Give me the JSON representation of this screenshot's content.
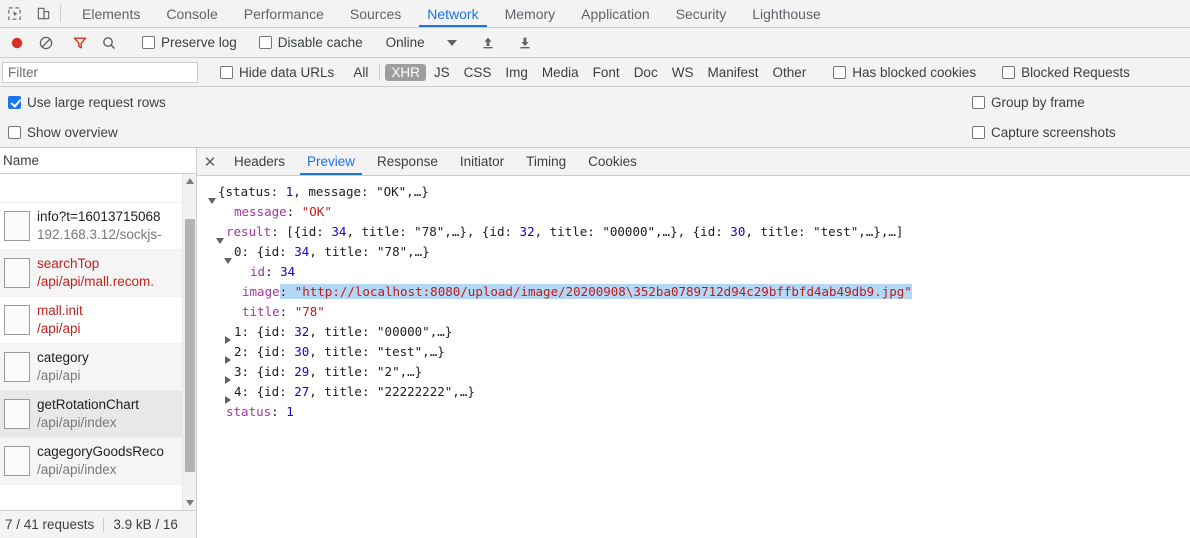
{
  "main_tabs": [
    {
      "label": "Elements",
      "active": false
    },
    {
      "label": "Console",
      "active": false
    },
    {
      "label": "Performance",
      "active": false
    },
    {
      "label": "Sources",
      "active": false
    },
    {
      "label": "Network",
      "active": true
    },
    {
      "label": "Memory",
      "active": false
    },
    {
      "label": "Application",
      "active": false
    },
    {
      "label": "Security",
      "active": false
    },
    {
      "label": "Lighthouse",
      "active": false
    }
  ],
  "toolbar": {
    "record_icon": "record-icon",
    "clear_icon": "clear-icon",
    "filter_icon": "filter-icon",
    "search_icon": "search-icon",
    "preserve_log": {
      "label": "Preserve log",
      "checked": false
    },
    "disable_cache": {
      "label": "Disable cache",
      "checked": false
    },
    "throttling": "Online",
    "import_icon": "upload-har-icon",
    "export_icon": "download-har-icon",
    "inspect_icon": "inspect-element-icon",
    "device_icon": "device-toolbar-icon"
  },
  "filterbar": {
    "placeholder": "Filter",
    "value": "",
    "hide_data_urls": {
      "label": "Hide data URLs",
      "checked": false
    },
    "types": [
      {
        "label": "All",
        "active": false
      },
      {
        "label": "XHR",
        "active": true
      },
      {
        "label": "JS",
        "active": false
      },
      {
        "label": "CSS",
        "active": false
      },
      {
        "label": "Img",
        "active": false
      },
      {
        "label": "Media",
        "active": false
      },
      {
        "label": "Font",
        "active": false
      },
      {
        "label": "Doc",
        "active": false
      },
      {
        "label": "WS",
        "active": false
      },
      {
        "label": "Manifest",
        "active": false
      },
      {
        "label": "Other",
        "active": false
      }
    ],
    "has_blocked_cookies": {
      "label": "Has blocked cookies",
      "checked": false
    },
    "blocked_requests": {
      "label": "Blocked Requests",
      "checked": false
    }
  },
  "settings": {
    "use_large_request_rows": {
      "label": "Use large request rows",
      "checked": true
    },
    "show_overview": {
      "label": "Show overview",
      "checked": false
    },
    "group_by_frame": {
      "label": "Group by frame",
      "checked": false
    },
    "capture_screenshots": {
      "label": "Capture screenshots",
      "checked": false
    }
  },
  "request_list": {
    "column_header": "Name",
    "rows": [
      {
        "name": "info?t=16013715068",
        "path": "192.168.3.12/sockjs-",
        "error": false,
        "selected": false
      },
      {
        "name": "searchTop",
        "path": "/api/api/mall.recom.",
        "error": true,
        "selected": false
      },
      {
        "name": "mall.init",
        "path": "/api/api",
        "error": true,
        "selected": false
      },
      {
        "name": "category",
        "path": "/api/api",
        "error": false,
        "selected": false
      },
      {
        "name": "getRotationChart",
        "path": "/api/api/index",
        "error": false,
        "selected": true
      },
      {
        "name": "cagegoryGoodsReco",
        "path": "/api/api/index",
        "error": false,
        "selected": false
      }
    ],
    "status": {
      "requests": "7 / 41 requests",
      "transferred": "3.9 kB / 16"
    }
  },
  "detail_tabs": [
    {
      "label": "Headers",
      "active": false
    },
    {
      "label": "Preview",
      "active": true
    },
    {
      "label": "Response",
      "active": false
    },
    {
      "label": "Initiator",
      "active": false
    },
    {
      "label": "Timing",
      "active": false
    },
    {
      "label": "Cookies",
      "active": false
    }
  ],
  "preview": {
    "lines": [
      {
        "indent": 0,
        "triangle": "open",
        "parts": [
          {
            "t": "{status: ",
            "c": "p"
          },
          {
            "t": "1",
            "c": "n"
          },
          {
            "t": ", message: ",
            "c": "p"
          },
          {
            "t": "\"OK\"",
            "c": "p"
          },
          {
            "t": ",…}",
            "c": "p"
          }
        ]
      },
      {
        "indent": 2,
        "triangle": "none",
        "parts": [
          {
            "t": "message",
            "c": "k"
          },
          {
            "t": ": ",
            "c": "p"
          },
          {
            "t": "\"OK\"",
            "c": "s"
          }
        ]
      },
      {
        "indent": 1,
        "triangle": "open",
        "parts": [
          {
            "t": "result",
            "c": "k"
          },
          {
            "t": ": [{id: ",
            "c": "p"
          },
          {
            "t": "34",
            "c": "n"
          },
          {
            "t": ", title: ",
            "c": "p"
          },
          {
            "t": "\"78\"",
            "c": "p"
          },
          {
            "t": ",…}, {id: ",
            "c": "p"
          },
          {
            "t": "32",
            "c": "n"
          },
          {
            "t": ", title: ",
            "c": "p"
          },
          {
            "t": "\"00000\"",
            "c": "p"
          },
          {
            "t": ",…}, {id: ",
            "c": "p"
          },
          {
            "t": "30",
            "c": "n"
          },
          {
            "t": ", title: ",
            "c": "p"
          },
          {
            "t": "\"test\"",
            "c": "p"
          },
          {
            "t": ",…},…]",
            "c": "p"
          }
        ]
      },
      {
        "indent": 2,
        "triangle": "open",
        "parts": [
          {
            "t": "0",
            "c": "p"
          },
          {
            "t": ": {id: ",
            "c": "p"
          },
          {
            "t": "34",
            "c": "n"
          },
          {
            "t": ", title: ",
            "c": "p"
          },
          {
            "t": "\"78\"",
            "c": "p"
          },
          {
            "t": ",…}",
            "c": "p"
          }
        ]
      },
      {
        "indent": 4,
        "triangle": "none",
        "parts": [
          {
            "t": "id",
            "c": "k"
          },
          {
            "t": ": ",
            "c": "p"
          },
          {
            "t": "34",
            "c": "n"
          }
        ]
      },
      {
        "indent": 3,
        "triangle": "none",
        "highlight_from": 1,
        "parts": [
          {
            "t": "image",
            "c": "k"
          },
          {
            "t": ": ",
            "c": "p"
          },
          {
            "t": "\"http://localhost:8080/upload/image/20200908\\352ba0789712d94c29bffbfd4ab49db9.jpg\"",
            "c": "s"
          }
        ]
      },
      {
        "indent": 3,
        "triangle": "none",
        "parts": [
          {
            "t": "title",
            "c": "k"
          },
          {
            "t": ": ",
            "c": "p"
          },
          {
            "t": "\"78\"",
            "c": "s"
          }
        ]
      },
      {
        "indent": 2,
        "triangle": "closed",
        "parts": [
          {
            "t": "1",
            "c": "p"
          },
          {
            "t": ": {id: ",
            "c": "p"
          },
          {
            "t": "32",
            "c": "n"
          },
          {
            "t": ", title: ",
            "c": "p"
          },
          {
            "t": "\"00000\"",
            "c": "p"
          },
          {
            "t": ",…}",
            "c": "p"
          }
        ]
      },
      {
        "indent": 2,
        "triangle": "closed",
        "parts": [
          {
            "t": "2",
            "c": "p"
          },
          {
            "t": ": {id: ",
            "c": "p"
          },
          {
            "t": "30",
            "c": "n"
          },
          {
            "t": ", title: ",
            "c": "p"
          },
          {
            "t": "\"test\"",
            "c": "p"
          },
          {
            "t": ",…}",
            "c": "p"
          }
        ]
      },
      {
        "indent": 2,
        "triangle": "closed",
        "parts": [
          {
            "t": "3",
            "c": "p"
          },
          {
            "t": ": {id: ",
            "c": "p"
          },
          {
            "t": "29",
            "c": "n"
          },
          {
            "t": ", title: ",
            "c": "p"
          },
          {
            "t": "\"2\"",
            "c": "p"
          },
          {
            "t": ",…}",
            "c": "p"
          }
        ]
      },
      {
        "indent": 2,
        "triangle": "closed",
        "parts": [
          {
            "t": "4",
            "c": "p"
          },
          {
            "t": ": {id: ",
            "c": "p"
          },
          {
            "t": "27",
            "c": "n"
          },
          {
            "t": ", title: ",
            "c": "p"
          },
          {
            "t": "\"22222222\"",
            "c": "p"
          },
          {
            "t": ",…}",
            "c": "p"
          }
        ]
      },
      {
        "indent": 1,
        "triangle": "none",
        "parts": [
          {
            "t": "status",
            "c": "k"
          },
          {
            "t": ": ",
            "c": "p"
          },
          {
            "t": "1",
            "c": "n"
          }
        ]
      }
    ]
  },
  "colors": {
    "accent": "#1a73e8",
    "error_text": "#c5221f",
    "record": "#d93025",
    "json_key": "#a336a3",
    "json_string": "#c41a16",
    "json_number": "#1c00cf",
    "highlight": "#b3d7f7"
  }
}
